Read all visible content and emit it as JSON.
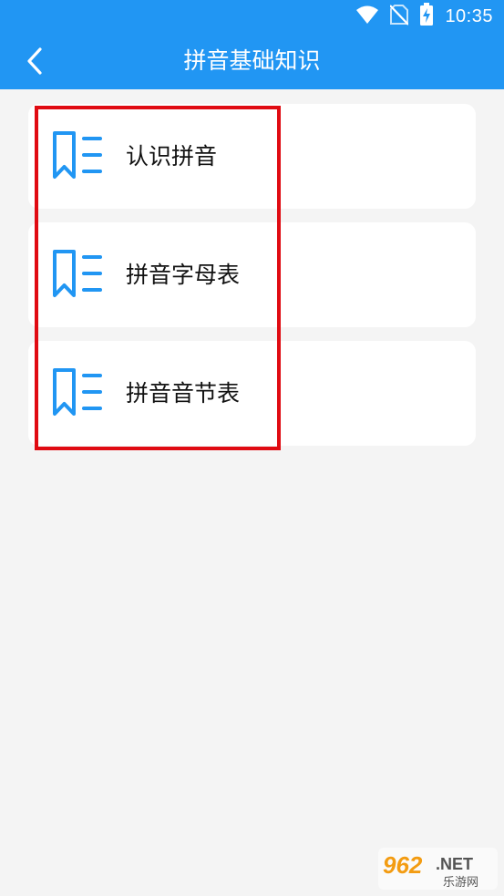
{
  "status_bar": {
    "time": "10:35",
    "icons": [
      "wifi-icon",
      "no-sim-icon",
      "battery-charging-icon"
    ]
  },
  "header": {
    "title": "拼音基础知识",
    "back_icon": "chevron-left-icon"
  },
  "colors": {
    "primary": "#2196f3",
    "background": "#f4f4f4",
    "card": "#ffffff",
    "highlight": "#e00b12",
    "icon": "#2196f3"
  },
  "list": {
    "items": [
      {
        "label": "认识拼音",
        "icon": "bookmark-list-icon"
      },
      {
        "label": "拼音字母表",
        "icon": "bookmark-list-icon"
      },
      {
        "label": "拼音音节表",
        "icon": "bookmark-list-icon"
      }
    ]
  },
  "watermark": {
    "brand": "962",
    "suffix": ".NET",
    "subtitle": "乐游网"
  }
}
